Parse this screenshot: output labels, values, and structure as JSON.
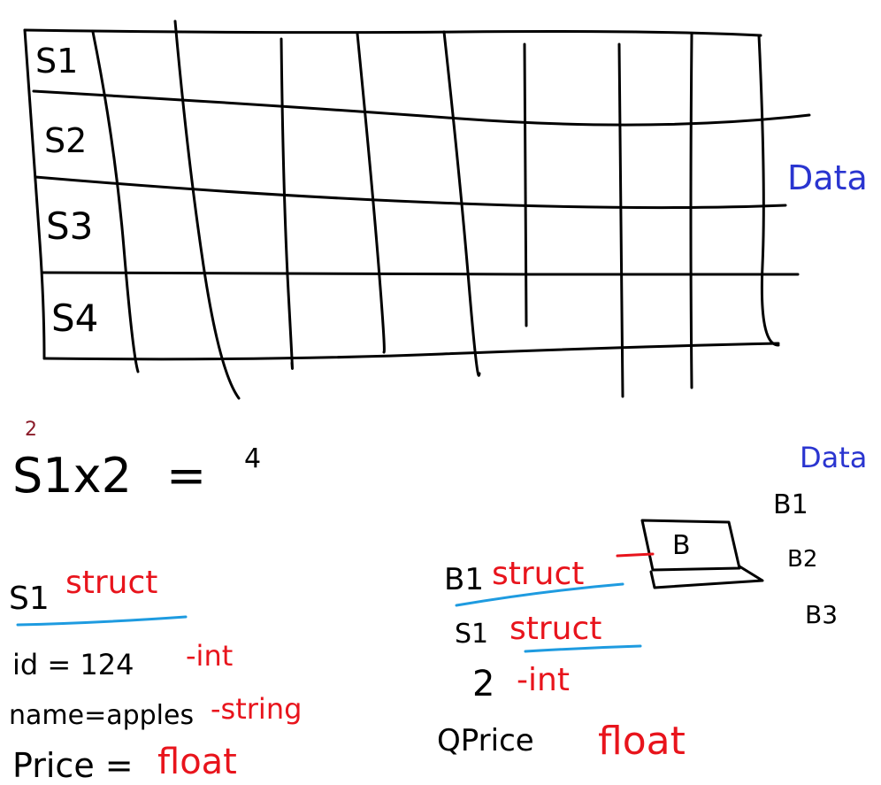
{
  "colors": {
    "black": "#000000",
    "red": "#e8141c",
    "blue": "#2a35d0",
    "cyan": "#1e9be0",
    "maroon": "#8b1c2a"
  },
  "grid": {
    "row_labels": [
      "S1",
      "S2",
      "S3",
      "S4"
    ]
  },
  "data_label_top": "Data",
  "equation": {
    "superscript": "2",
    "lhs": "S1x2",
    "equals": "=",
    "rhs": "4"
  },
  "left_block": {
    "heading": "S1",
    "heading_type": "struct",
    "fields": [
      {
        "text": "id = 124",
        "type": "int"
      },
      {
        "text": "name=apples",
        "type": "string"
      },
      {
        "text": "Price =",
        "type": "float"
      }
    ]
  },
  "right_block": {
    "data_label": "Data",
    "box_label": "B",
    "b_list": [
      "B1",
      "B2",
      "B3"
    ],
    "lines": [
      {
        "text": "B1",
        "type": "struct"
      },
      {
        "text": "S1",
        "type": "struct"
      },
      {
        "text": "2",
        "type": "int"
      },
      {
        "text": "QPrice",
        "type": "float"
      }
    ]
  }
}
